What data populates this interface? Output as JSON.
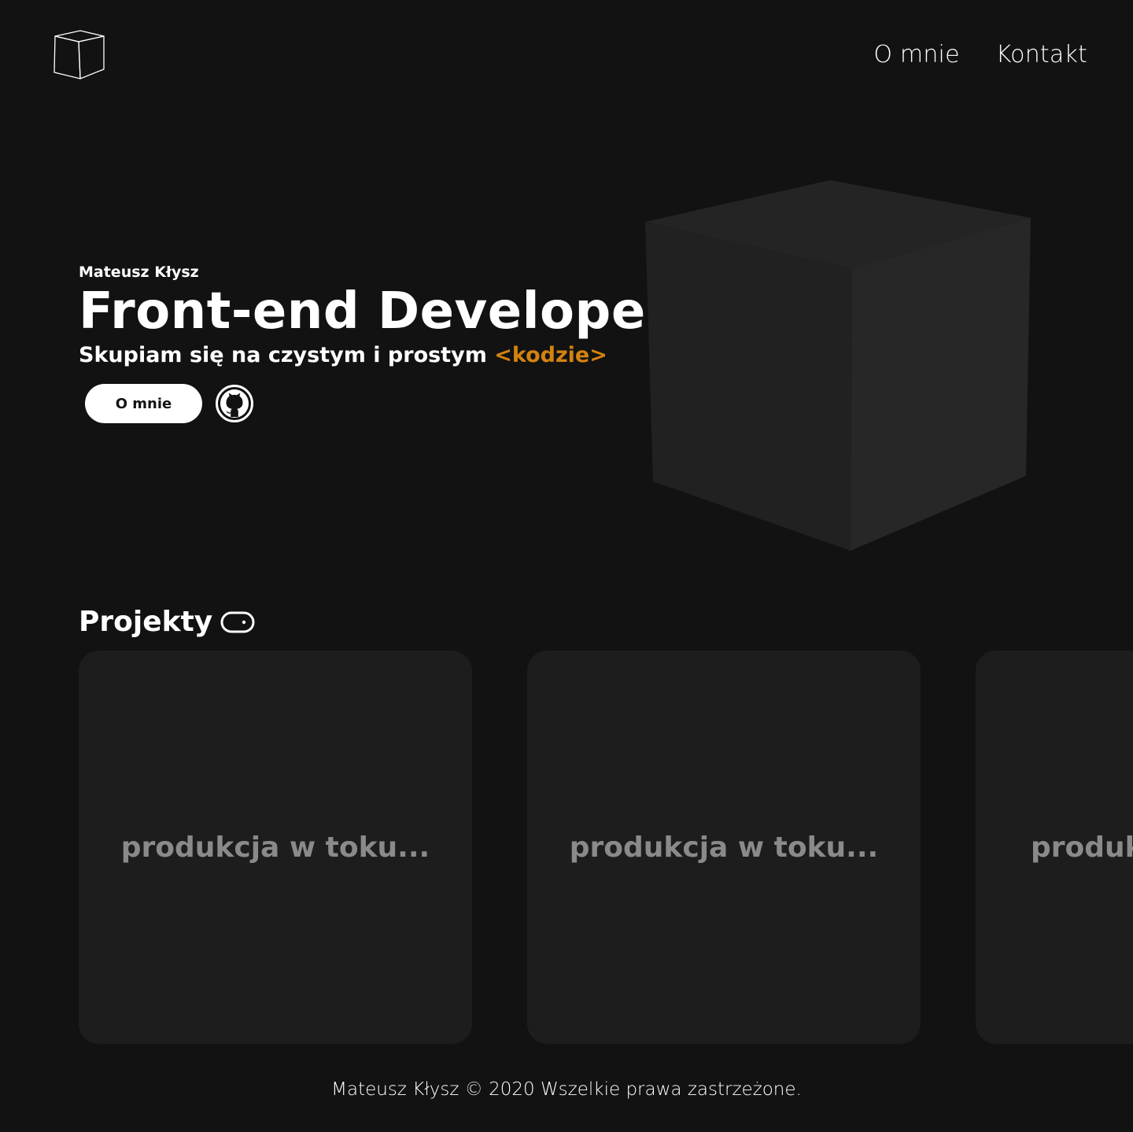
{
  "header": {
    "logo_icon": "cube-outline-icon",
    "nav": [
      {
        "label": "O mnie"
      },
      {
        "label": "Kontakt"
      }
    ]
  },
  "hero": {
    "name": "Mateusz Kłysz",
    "title": "Front-end Developer",
    "subtitle_prefix": "Skupiam się na czystym i prostym ",
    "subtitle_accent": "<kodzie>",
    "about_button": "O mnie",
    "github_icon": "github-icon",
    "illustration_icon": "cube-icon"
  },
  "projects": {
    "title": "Projekty",
    "toggle_icon": "toggle-icon",
    "cards": [
      {
        "label": "produkcja w toku..."
      },
      {
        "label": "produkcja w toku..."
      },
      {
        "label": "produkcja w toku..."
      }
    ]
  },
  "footer": {
    "text": "Mateusz Kłysz © 2020 Wszelkie prawa zastrzeżone."
  },
  "colors": {
    "background": "#121212",
    "card": "#1d1d1d",
    "accent": "#d4830f",
    "card_text": "#8a8a8a"
  }
}
